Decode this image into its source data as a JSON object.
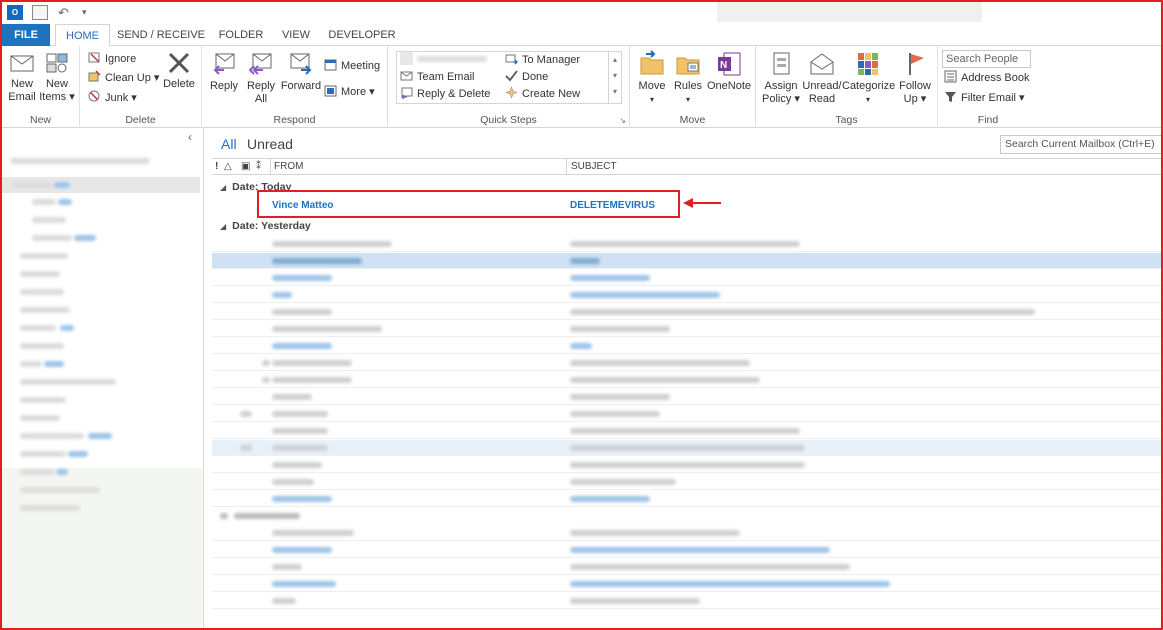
{
  "quick_access": {
    "outlook_icon": "outlook-logo-icon",
    "send_receive_icon": "send-receive-all-icon",
    "undo_icon": "undo-icon",
    "customize_icon": "customize-toolbar-icon"
  },
  "tabs": [
    "FILE",
    "HOME",
    "SEND / RECEIVE",
    "FOLDER",
    "VIEW",
    "DEVELOPER"
  ],
  "ribbon": {
    "new": {
      "new_email": [
        "New",
        "Email"
      ],
      "new_items": [
        "New",
        "Items ▾"
      ],
      "label": "New"
    },
    "delete": {
      "ignore": "Ignore",
      "clean_up": "Clean Up ▾",
      "junk": "Junk ▾",
      "delete": "Delete",
      "label": "Delete"
    },
    "respond": {
      "reply": "Reply",
      "reply_all": [
        "Reply",
        "All"
      ],
      "forward": "Forward",
      "meeting": "Meeting",
      "more": "More ▾",
      "label": "Respond"
    },
    "quick_steps": {
      "items": [
        "Team Email",
        "Reply & Delete",
        "To Manager",
        "Done",
        "Create New"
      ],
      "label": "Quick Steps"
    },
    "move": {
      "move": "Move",
      "rules": "Rules",
      "onenote": "OneNote",
      "label": "Move"
    },
    "tags": {
      "assign_policy": [
        "Assign",
        "Policy ▾"
      ],
      "unread_read": [
        "Unread/",
        "Read"
      ],
      "categorize": "Categorize",
      "follow_up": [
        "Follow",
        "Up ▾"
      ],
      "label": "Tags"
    },
    "find": {
      "search_people": "Search People",
      "address_book": "Address Book",
      "filter_email": "Filter Email ▾",
      "label": "Find"
    }
  },
  "mail": {
    "filters": [
      "All",
      "Unread"
    ],
    "search_placeholder": "Search Current Mailbox (Ctrl+E)",
    "columns": {
      "from": "FROM",
      "subject": "SUBJECT"
    },
    "groups": [
      "Date: Today",
      "Date: Yesterday"
    ],
    "highlighted_message": {
      "from": "Vince Matteo",
      "subject": "DELETEMEVIRUS"
    }
  },
  "colors": {
    "accent": "#1e73be",
    "file_tab": "#1e73be",
    "annotation": "#e02020",
    "selected_row": "#cfe2f3"
  }
}
